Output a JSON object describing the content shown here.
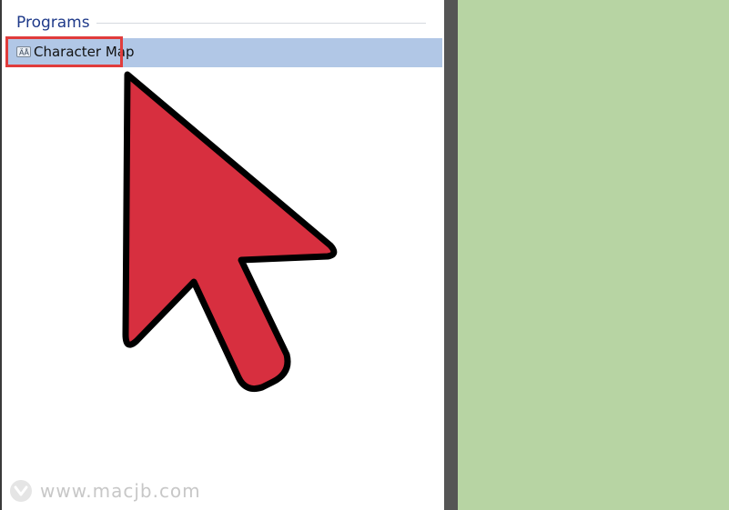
{
  "search_results": {
    "section_title": "Programs",
    "items": [
      {
        "label": "Character Map",
        "icon": "character-map-icon",
        "selected": true
      }
    ]
  },
  "annotation": {
    "pointer": "red-arrow-cursor",
    "highlight_color": "#e03c3c",
    "arrow_color": "#d72f3f"
  },
  "colors": {
    "selection": "#b1c7e6",
    "section_title": "#1f3a8a",
    "side_background": "#b7d4a3",
    "divider": "#555555"
  },
  "watermark": {
    "text": "www.macjb.com"
  }
}
